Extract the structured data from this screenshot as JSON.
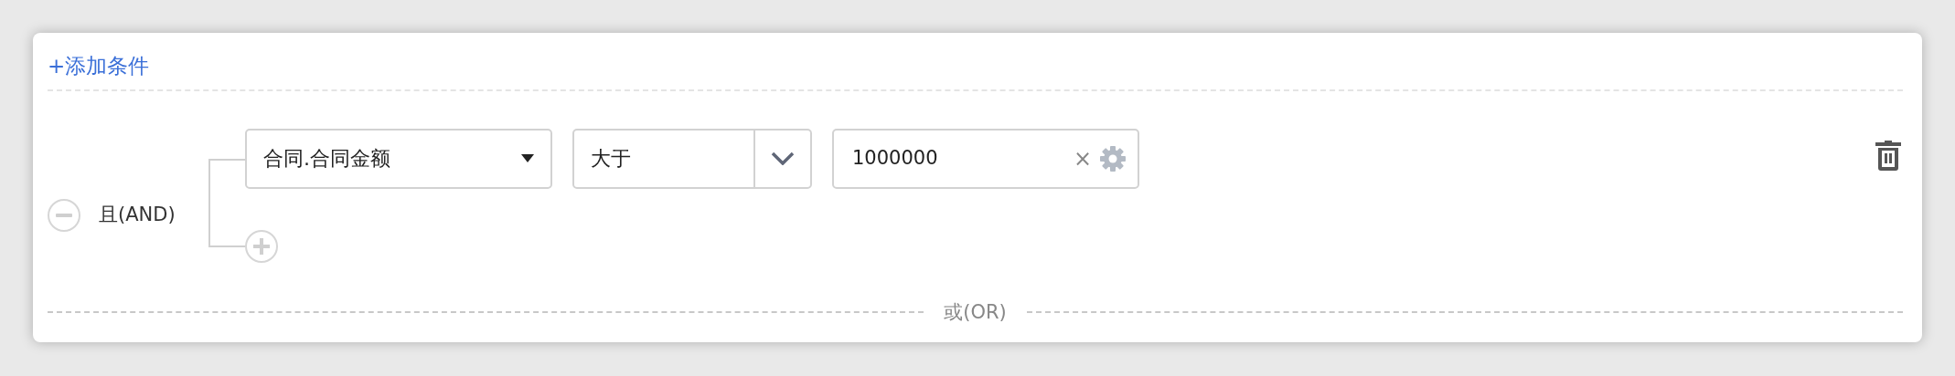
{
  "add_condition": {
    "label": "+添加条件"
  },
  "group": {
    "logic_label": "且(AND)",
    "conditions": [
      {
        "field": {
          "value": "合同.合同金额"
        },
        "operator": {
          "value": "大于"
        },
        "value": {
          "value": "1000000",
          "clear_label": "×"
        }
      }
    ]
  },
  "separator": {
    "label": "或(OR)"
  }
}
